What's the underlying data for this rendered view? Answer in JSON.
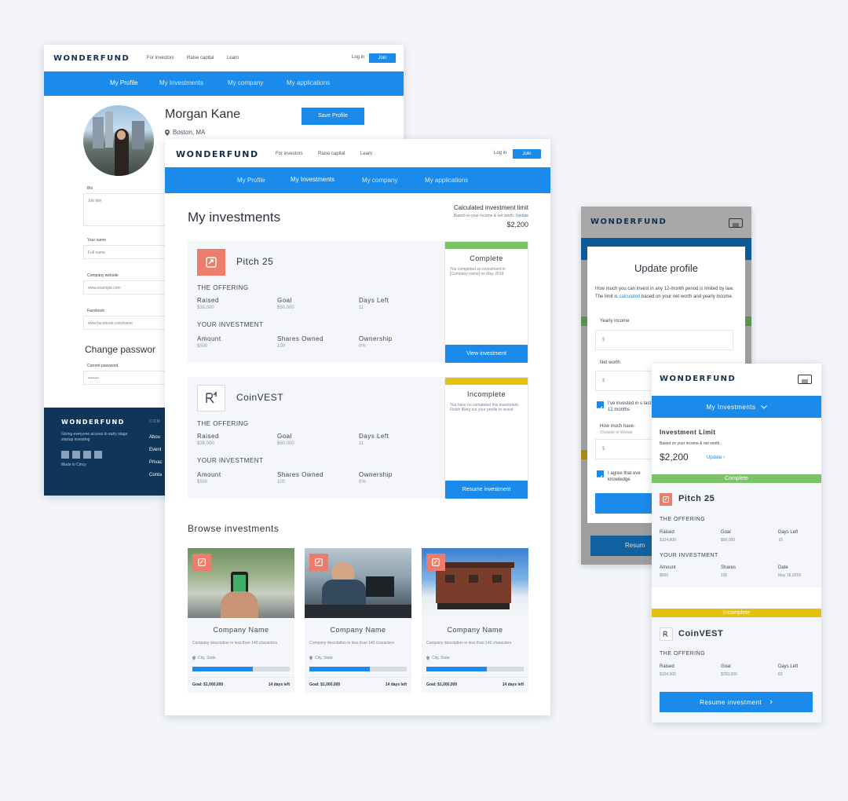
{
  "brand": {
    "logo": "WONDERFUND",
    "logo_colors": {
      "navy": "#15304c",
      "accent": "#1a8bea"
    }
  },
  "desktop_profile": {
    "nav": {
      "links": [
        "For investors",
        "Raise capital",
        "Learn"
      ],
      "login": "Log in",
      "join": "Join"
    },
    "tabs": [
      "My Profile",
      "My Investments",
      "My company",
      "My applications"
    ],
    "name": "Morgan Kane",
    "location": "Boston, MA",
    "save_button": "Save Profile",
    "fields": [
      {
        "label": "Bio",
        "placeholder": "Job title"
      },
      {
        "label": "Your name",
        "placeholder": "Full name"
      },
      {
        "label": "Company website",
        "placeholder": "www.example.com"
      },
      {
        "label": "Facebook",
        "placeholder": "www.facebook.com/name"
      }
    ],
    "change_password": "Change passwor",
    "current_password_label": "Current password",
    "current_password_value": "••••••••",
    "footer": {
      "logo": "WONDERFUND",
      "tagline": "Giving everyone access to early stage startup investing",
      "made_in": "Made in Cincy",
      "column_head": "COM",
      "links": [
        "Abou",
        "Event",
        "Privac",
        "Conta"
      ]
    }
  },
  "desktop_investments": {
    "nav": {
      "links": [
        "For investors",
        "Raise capital",
        "Learn"
      ],
      "login": "Log in",
      "join": "Join"
    },
    "tabs": [
      "My Profile",
      "My Investments",
      "My company",
      "My applications"
    ],
    "title": "My investments",
    "limit": {
      "title": "Calculated investment limit",
      "note": "Based on your  income & net worth.",
      "update": "Update",
      "value": "$2,200"
    },
    "investments": [
      {
        "name": "Pitch 25",
        "icon": "pitch-logo-icon",
        "status": "Complete",
        "status_color": "#7cc269",
        "status_note": "You completed an investment in [Company name] on May 2018.",
        "action": "View investment",
        "offering": "THE OFFERING",
        "stats": [
          {
            "label": "Raised",
            "value": "$38,000"
          },
          {
            "label": "Goal",
            "value": "$50,000"
          },
          {
            "label": "Days Left",
            "value": "11"
          }
        ],
        "your": "YOUR INVESTMENT",
        "your_stats": [
          {
            "label": "Amount",
            "value": "$500"
          },
          {
            "label": "Shares Owned",
            "value": "100"
          },
          {
            "label": "Ownership",
            "value": "0%"
          }
        ]
      },
      {
        "name": "CoinVEST",
        "icon": "coinvest-logo-icon",
        "status": "Incomplete",
        "status_color": "#e3c10f",
        "status_note": "You have no completed this investment. Finish filling out your profile to invest",
        "action": "Resume investment",
        "offering": "THE OFFERING",
        "stats": [
          {
            "label": "Raised",
            "value": "$38,000"
          },
          {
            "label": "Goal",
            "value": "$50,000"
          },
          {
            "label": "Days Left",
            "value": "11"
          }
        ],
        "your": "YOUR INVESTMENT",
        "your_stats": [
          {
            "label": "Amount",
            "value": "$500"
          },
          {
            "label": "Shares Owned",
            "value": "100"
          },
          {
            "label": "Ownership",
            "value": "0%"
          }
        ]
      }
    ],
    "browse_title": "Browse investments",
    "browse": [
      {
        "name": "Company Name",
        "desc": "Company description in less than 140 characters",
        "loc": "City, State",
        "goal": "Goal: $1,000,000",
        "days": "14 days left",
        "progress": 0.62,
        "photo": "phone-in-hand-photo"
      },
      {
        "name": "Company Name",
        "desc": "Company description in less than 140 characters",
        "loc": "City, State",
        "goal": "Goal: $1,000,000",
        "days": "14 days left",
        "progress": 0.62,
        "photo": "cafe-laptop-photo"
      },
      {
        "name": "Company Name",
        "desc": "Company description in less than 140 characters",
        "loc": "City, State",
        "goal": "Goal: $1,000,000",
        "days": "14 days left",
        "progress": 0.62,
        "photo": "train-car-photo"
      }
    ]
  },
  "mobile_update": {
    "logo": "WONDERFUND",
    "title": "Update profile",
    "intro_pre": "How much you can invest in any 12-month period is limited by law. The limit is ",
    "intro_link": "calculated",
    "intro_post": " based on your net worth and yearly income.",
    "yearly_label": "Yearly income",
    "yearly_ph": "$",
    "net_label": "Net worth",
    "net_ph": "$",
    "check1": "I've invested in s last 12 months",
    "q_label": "How much have-",
    "q_sub": "(Outside of Wonde",
    "q_ph": "$",
    "check2": "I agree that eve knowledge",
    "resume": "Resum"
  },
  "mobile_investments": {
    "logo": "WONDERFUND",
    "dropdown": "My Investments",
    "limit_title": "Investment Limit",
    "limit_note": "Based on your  income & net worth.",
    "limit_value": "$2,200",
    "update": "Update",
    "cards": [
      {
        "status": "Complete",
        "name": "Pitch 25",
        "offering": "THE OFFERING",
        "stats": [
          {
            "label": "Raised",
            "value": "$104,600"
          },
          {
            "label": "Goal",
            "value": "$50,000"
          },
          {
            "label": "Days Left",
            "value": "10"
          }
        ],
        "your": "YOUR INVESTMENT",
        "your_stats": [
          {
            "label": "Amount",
            "value": "$500"
          },
          {
            "label": "Shares",
            "value": "100"
          },
          {
            "label": "Date",
            "value": "May 16,2018"
          }
        ]
      },
      {
        "status": "Incomplete",
        "name": "CoinVEST",
        "offering": "THE OFFERING",
        "stats": [
          {
            "label": "Raised",
            "value": "$104,600"
          },
          {
            "label": "Goal",
            "value": "$250,000"
          },
          {
            "label": "Days Left",
            "value": "83"
          }
        ]
      }
    ],
    "resume": "Resume investment"
  }
}
